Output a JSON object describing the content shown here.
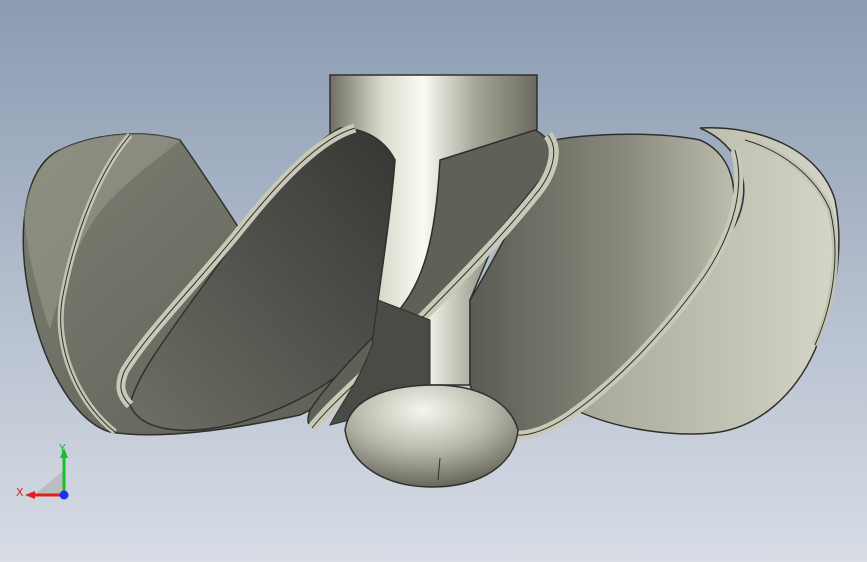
{
  "viewport": {
    "background_top": "#8b9bb2",
    "background_bottom": "#d8dde6"
  },
  "model": {
    "icon": "propeller-model",
    "blade_color": "#7b7c70",
    "blade_edge_color": "#c4c4b2",
    "hub_color": "#cfcfc4"
  },
  "triad": {
    "x_label": "X",
    "y_label": "Y",
    "x_color": "#e0201c",
    "y_color": "#16c02a",
    "z_color": "#1a34e8"
  }
}
